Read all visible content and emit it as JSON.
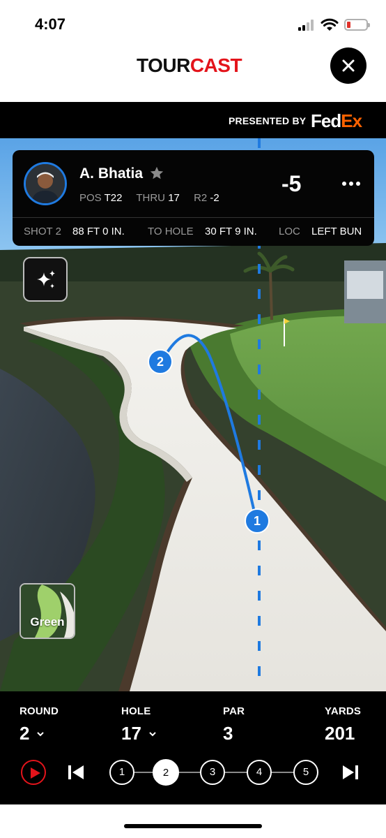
{
  "status_bar": {
    "time": "4:07"
  },
  "header": {
    "logo_part1": "TOUR",
    "logo_part2": "CAST"
  },
  "sponsor": {
    "presented_by": "PRESENTED BY",
    "brand_part1": "Fed",
    "brand_part2": "Ex"
  },
  "player": {
    "name": "A. Bhatia",
    "pos_label": "POS",
    "pos_value": "T22",
    "thru_label": "THRU",
    "thru_value": "17",
    "round_label": "R2",
    "round_value": "-2",
    "score": "-5"
  },
  "shot_info": {
    "shot_label": "SHOT 2",
    "shot_value": "88 FT 0 IN.",
    "to_hole_label": "TO HOLE",
    "to_hole_value": "30 FT 9 IN.",
    "loc_label": "LOC",
    "loc_value": "LEFT BUN"
  },
  "view": {
    "green_label": "Green"
  },
  "shot_markers": [
    "1",
    "2"
  ],
  "hole_info": {
    "round_label": "ROUND",
    "round_value": "2",
    "hole_label": "HOLE",
    "hole_value": "17",
    "par_label": "PAR",
    "par_value": "3",
    "yards_label": "YARDS",
    "yards_value": "201"
  },
  "shot_steps": [
    "1",
    "2",
    "3",
    "4",
    "5"
  ],
  "active_step": "2",
  "colors": {
    "brand_red": "#e3141b",
    "accent_blue": "#1f7ae0",
    "fedex_orange": "#ff6200"
  }
}
